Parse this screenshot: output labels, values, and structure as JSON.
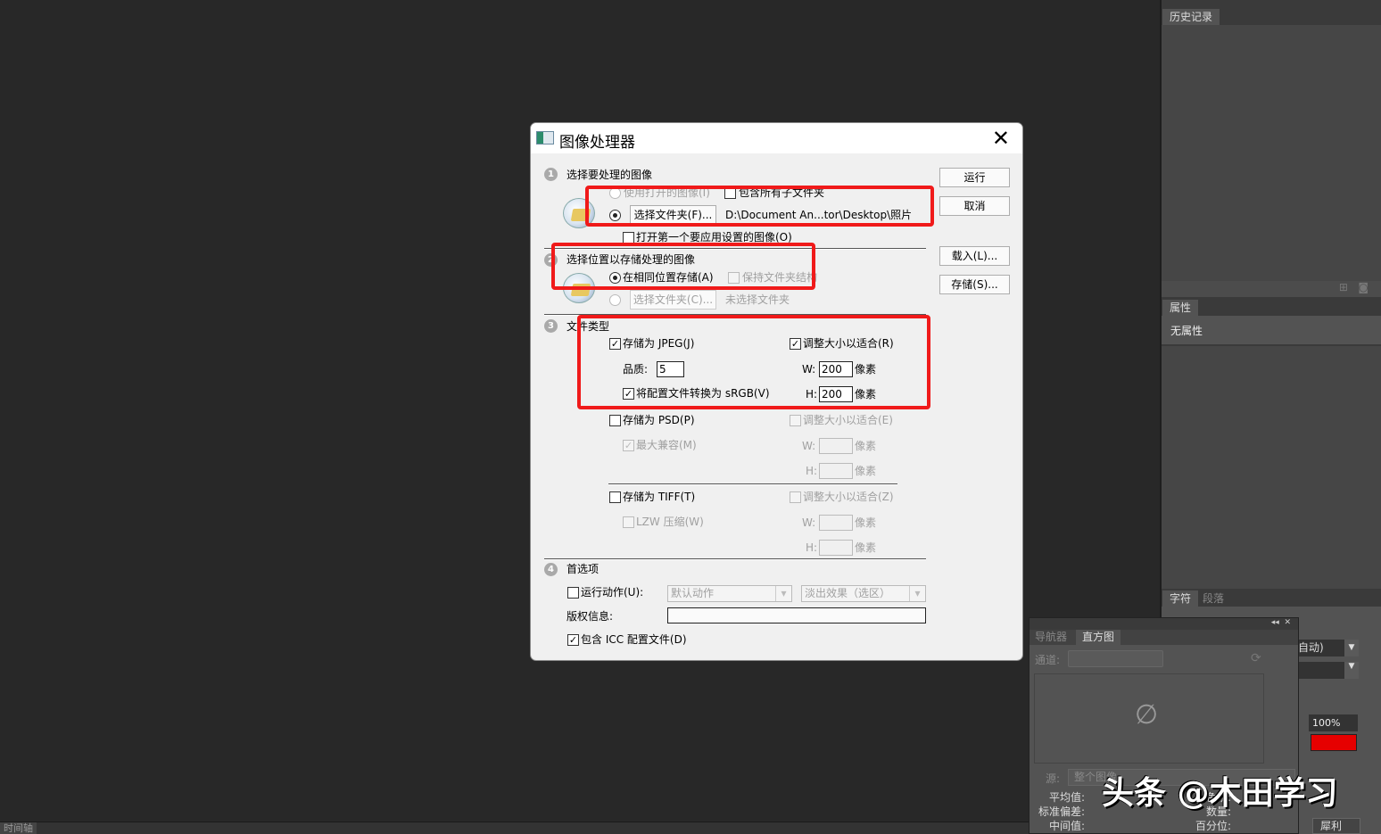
{
  "app": {
    "timeline_tab": "时间轴"
  },
  "panels": {
    "history": {
      "tab": "历史记录"
    },
    "properties": {
      "tab": "属性",
      "content": "无属性"
    },
    "character": {
      "tabs": [
        "字符",
        "段落"
      ],
      "scale": "100%",
      "auto_fragment": "自动)",
      "antialias": "犀利",
      "color_swatch": "#e60000"
    },
    "histogram": {
      "tabs": [
        "导航器",
        "直方图"
      ],
      "channel_label": "通道:",
      "source_label": "源:",
      "source_value": "整个图像",
      "stats_left": [
        "平均值:",
        "标准偏差:",
        "中间值:"
      ],
      "stats_right": [
        "色阶:",
        "数量:",
        "百分位:"
      ]
    }
  },
  "dialog": {
    "title": "图像处理器",
    "buttons": {
      "run": "运行",
      "cancel": "取消",
      "load": "载入(L)...",
      "save": "存储(S)..."
    },
    "s1": {
      "num": "1",
      "title": "选择要处理的图像",
      "use_open": "使用打开的图像(I)",
      "include_sub": "包含所有子文件夹",
      "select_folder": "选择文件夹(F)...",
      "path": "D:\\Document An...tor\\Desktop\\照片",
      "open_first": "打开第一个要应用设置的图像(O)"
    },
    "s2": {
      "num": "2",
      "title": "选择位置以存储处理的图像",
      "same_loc": "在相同位置存储(A)",
      "keep_struct": "保持文件夹结构",
      "select_folder": "选择文件夹(C)...",
      "no_folder": "未选择文件夹"
    },
    "s3": {
      "num": "3",
      "title": "文件类型",
      "jpeg": {
        "label": "存储为 JPEG(J)",
        "checked": true,
        "resize": "调整大小以适合(R)",
        "quality_label": "品质:",
        "quality": "5",
        "srgb": "将配置文件转换为 sRGB(V)",
        "w": "200",
        "h": "200"
      },
      "psd": {
        "label": "存储为 PSD(P)",
        "resize": "调整大小以适合(E)",
        "max_compat": "最大兼容(M)"
      },
      "tiff": {
        "label": "存储为 TIFF(T)",
        "resize": "调整大小以适合(Z)",
        "lzw": "LZW 压缩(W)"
      },
      "w_label": "W:",
      "h_label": "H:",
      "px": "像素"
    },
    "s4": {
      "num": "4",
      "title": "首选项",
      "run_action": "运行动作(U):",
      "action_set": "默认动作",
      "action": "淡出效果（选区）",
      "copyright": "版权信息:",
      "copyright_value": "",
      "icc": "包含 ICC 配置文件(D)"
    }
  },
  "watermark": "头条 @木田学习"
}
